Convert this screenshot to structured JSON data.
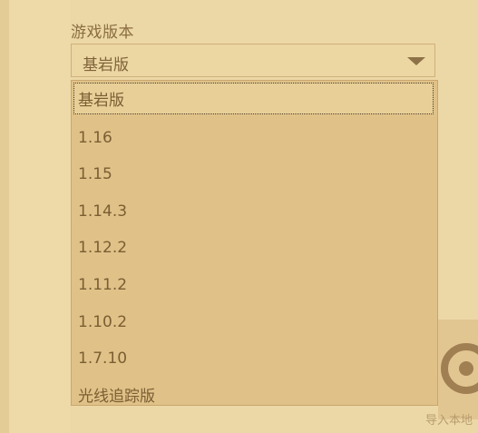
{
  "game_version": {
    "label": "游戏版本",
    "selected": "基岩版",
    "options": [
      "基岩版",
      "1.16",
      "1.15",
      "1.14.3",
      "1.12.2",
      "1.11.2",
      "1.10.2",
      "1.7.10",
      "光线追踪版"
    ]
  },
  "background": {
    "import_local_label": "导入本地"
  },
  "colors": {
    "page": "#eddaa8",
    "dropdown": "#e0c288",
    "text": "#7a5e33"
  }
}
